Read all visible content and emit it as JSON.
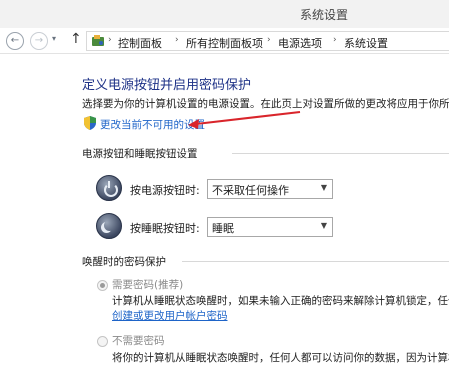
{
  "window": {
    "title": "系统设置"
  },
  "nav": {
    "back": "←",
    "forward": "→",
    "dropdown": "▾",
    "up": "↑"
  },
  "breadcrumb": {
    "separator": "›",
    "items": [
      "控制面板",
      "所有控制面板项",
      "电源选项",
      "系统设置"
    ]
  },
  "main": {
    "heading": "定义电源按钮并启用密码保护",
    "description": "选择要为你的计算机设置的电源设置。在此页上对设置所做的更改将应用于你所有",
    "change_link": "更改当前不可用的设置"
  },
  "power_section": {
    "title": "电源按钮和睡眠按钮设置",
    "rows": [
      {
        "label": "按电源按钮时:",
        "value": "不采取任何操作",
        "icon": "power-icon"
      },
      {
        "label": "按睡眠按钮时:",
        "value": "睡眠",
        "icon": "sleep-moon-icon"
      }
    ]
  },
  "wake_section": {
    "title": "唤醒时的密码保护",
    "options": [
      {
        "label": "需要密码(推荐)",
        "selected": true,
        "description": "计算机从睡眠状态唤醒时，如果未输入正确的密码来解除计算机锁定，任何",
        "link": "创建或更改用户帐户密码"
      },
      {
        "label": "不需要密码",
        "selected": false,
        "description": "将你的计算机从睡眠状态唤醒时，任何人都可以访问你的数据，因为计算机"
      }
    ]
  },
  "colors": {
    "heading": "#1e3287",
    "link": "#1e64c8",
    "annotation_arrow": "#d9252b"
  }
}
